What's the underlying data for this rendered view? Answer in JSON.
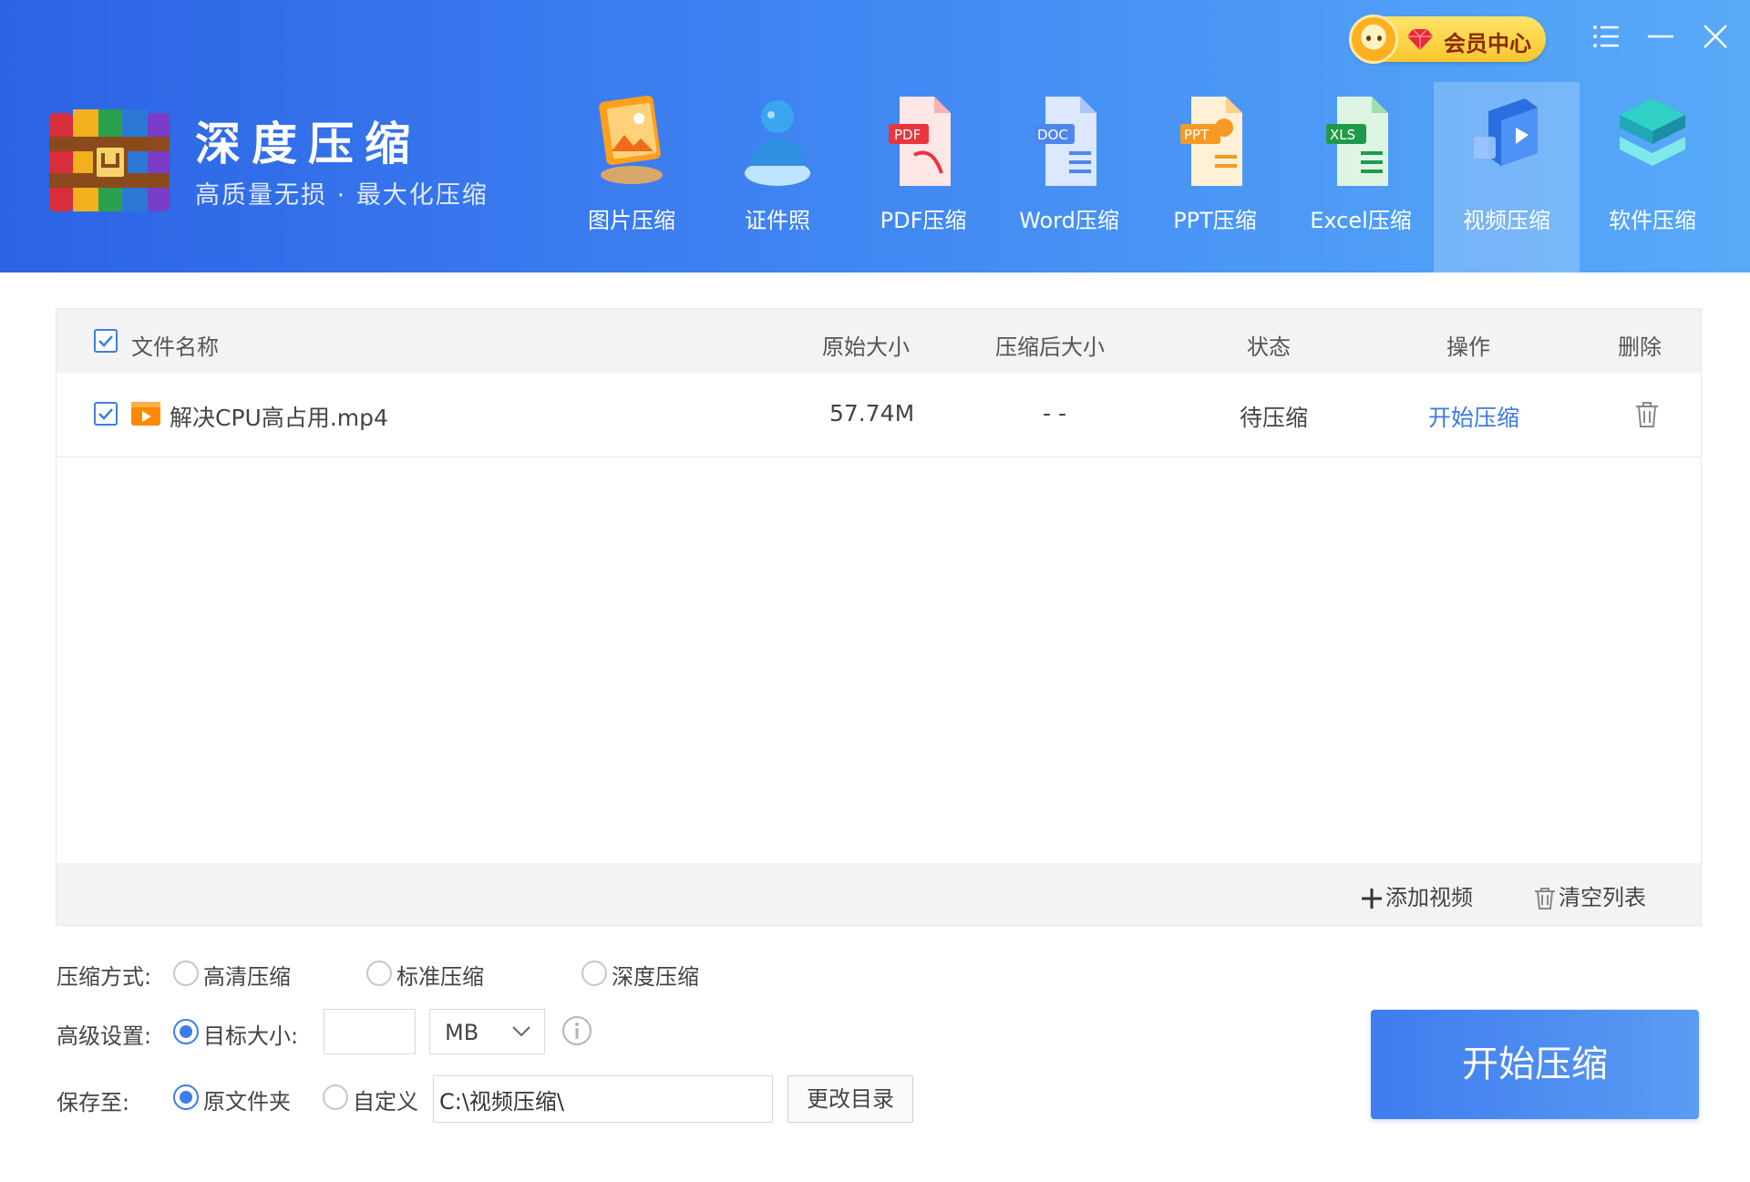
{
  "app": {
    "title": "深度压缩",
    "subtitle": "高质量无损 · 最大化压缩"
  },
  "vip": {
    "label": "会员中心"
  },
  "window_controls": {
    "menu_icon": "hamburger-menu-icon",
    "minimize_icon": "minimize-icon",
    "close_icon": "close-icon"
  },
  "tools": [
    {
      "label": "图片压缩",
      "icon": "image-icon",
      "active": false
    },
    {
      "label": "证件照",
      "icon": "id-photo-icon",
      "active": false
    },
    {
      "label": "PDF压缩",
      "icon": "pdf-icon",
      "active": false
    },
    {
      "label": "Word压缩",
      "icon": "word-icon",
      "active": false
    },
    {
      "label": "PPT压缩",
      "icon": "ppt-icon",
      "active": false
    },
    {
      "label": "Excel压缩",
      "icon": "excel-icon",
      "active": false
    },
    {
      "label": "视频压缩",
      "icon": "video-icon",
      "active": true
    },
    {
      "label": "软件压缩",
      "icon": "software-icon",
      "active": false
    }
  ],
  "table": {
    "headers": {
      "name": "文件名称",
      "original_size": "原始大小",
      "compressed_size": "压缩后大小",
      "status": "状态",
      "action": "操作",
      "delete": "删除"
    },
    "rows": [
      {
        "checked": true,
        "name": "解决CPU高占用.mp4",
        "original_size": "57.74M",
        "compressed_size": "- -",
        "status": "待压缩",
        "action": "开始压缩"
      }
    ],
    "footer": {
      "add_label": "添加视频",
      "clear_label": "清空列表"
    }
  },
  "settings": {
    "mode_label": "压缩方式:",
    "modes": [
      "高清压缩",
      "标准压缩",
      "深度压缩"
    ],
    "advanced_label": "高级设置:",
    "target_size_label": "目标大小:",
    "target_size_value": "",
    "unit": "MB",
    "save_label": "保存至:",
    "save_options": [
      "原文件夹",
      "自定义"
    ],
    "save_path": "C:\\视频压缩\\",
    "change_dir_label": "更改目录"
  },
  "start_button": {
    "label": "开始压缩"
  },
  "colors": {
    "header_start": "#2b63e4",
    "header_end": "#58aaf8",
    "accent": "#3d7ee6",
    "link": "#3c79e3"
  }
}
